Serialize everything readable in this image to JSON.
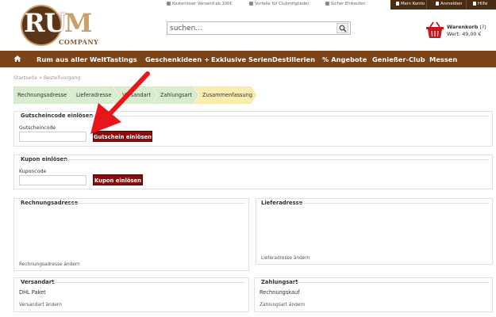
{
  "topbar": {
    "shipping": "Kostenloser Versand ab 100€",
    "club": "Vorteile für Clubmitglieder",
    "secure": "Sicher Einkaufen",
    "account": "Mein Konto",
    "login": "Anmelden",
    "help": "Hilfe"
  },
  "logo": {
    "letters": "RU",
    "m": "M",
    "company": "COMPANY"
  },
  "search": {
    "placeholder": "suchen..."
  },
  "cart": {
    "label": "Warenkorb",
    "count": "(?)",
    "value": "Wert: 49,00 €"
  },
  "nav": {
    "items": [
      {
        "label": "Rum aus aller Welt"
      },
      {
        "label": "Tastings"
      },
      {
        "label": "Geschenkideen +"
      },
      {
        "label": "Exklusive Serien"
      },
      {
        "label": "Destillerien"
      },
      {
        "label": "% Angebote"
      },
      {
        "label": "Genießer-Club"
      },
      {
        "label": "Messen"
      }
    ]
  },
  "breadcrumb": "Startseite » Bestellvorgang",
  "steps": [
    {
      "label": "Rechnungsadresse",
      "state": "done"
    },
    {
      "label": "Lieferadresse",
      "state": "done"
    },
    {
      "label": "Versandart",
      "state": "done"
    },
    {
      "label": "Zahlungsart",
      "state": "done"
    },
    {
      "label": "Zusammenfassung",
      "state": "active"
    }
  ],
  "colors": {
    "brand_brown": "#7b4318",
    "account_bar": "#4a2c12",
    "button_red": "#8b0c0c",
    "step_done": "#d9ecd0",
    "step_active": "#fbecb0",
    "arrow_red": "#e8151b"
  },
  "gutschein": {
    "title": "Gutscheincode einlösen",
    "field_label": "Gutscheincode",
    "value": "",
    "button": "Gutschein einlösen"
  },
  "kupon": {
    "title": "Kupon einlösen",
    "field_label": "Kuponcode",
    "value": "",
    "button": "Kupon einlösen"
  },
  "rechnung": {
    "title": "Rechnungsadresse",
    "link": "Rechnungsadresse ändern"
  },
  "liefer": {
    "title": "Lieferadresse",
    "link": "Lieferadresse ändern"
  },
  "versand": {
    "title": "Versandart",
    "value": "DHL Paket",
    "link": "Versandart ändern"
  },
  "zahlung": {
    "title": "Zahlungsart",
    "value": "Rechnungskauf",
    "link": "Zahlungsart ändern"
  }
}
